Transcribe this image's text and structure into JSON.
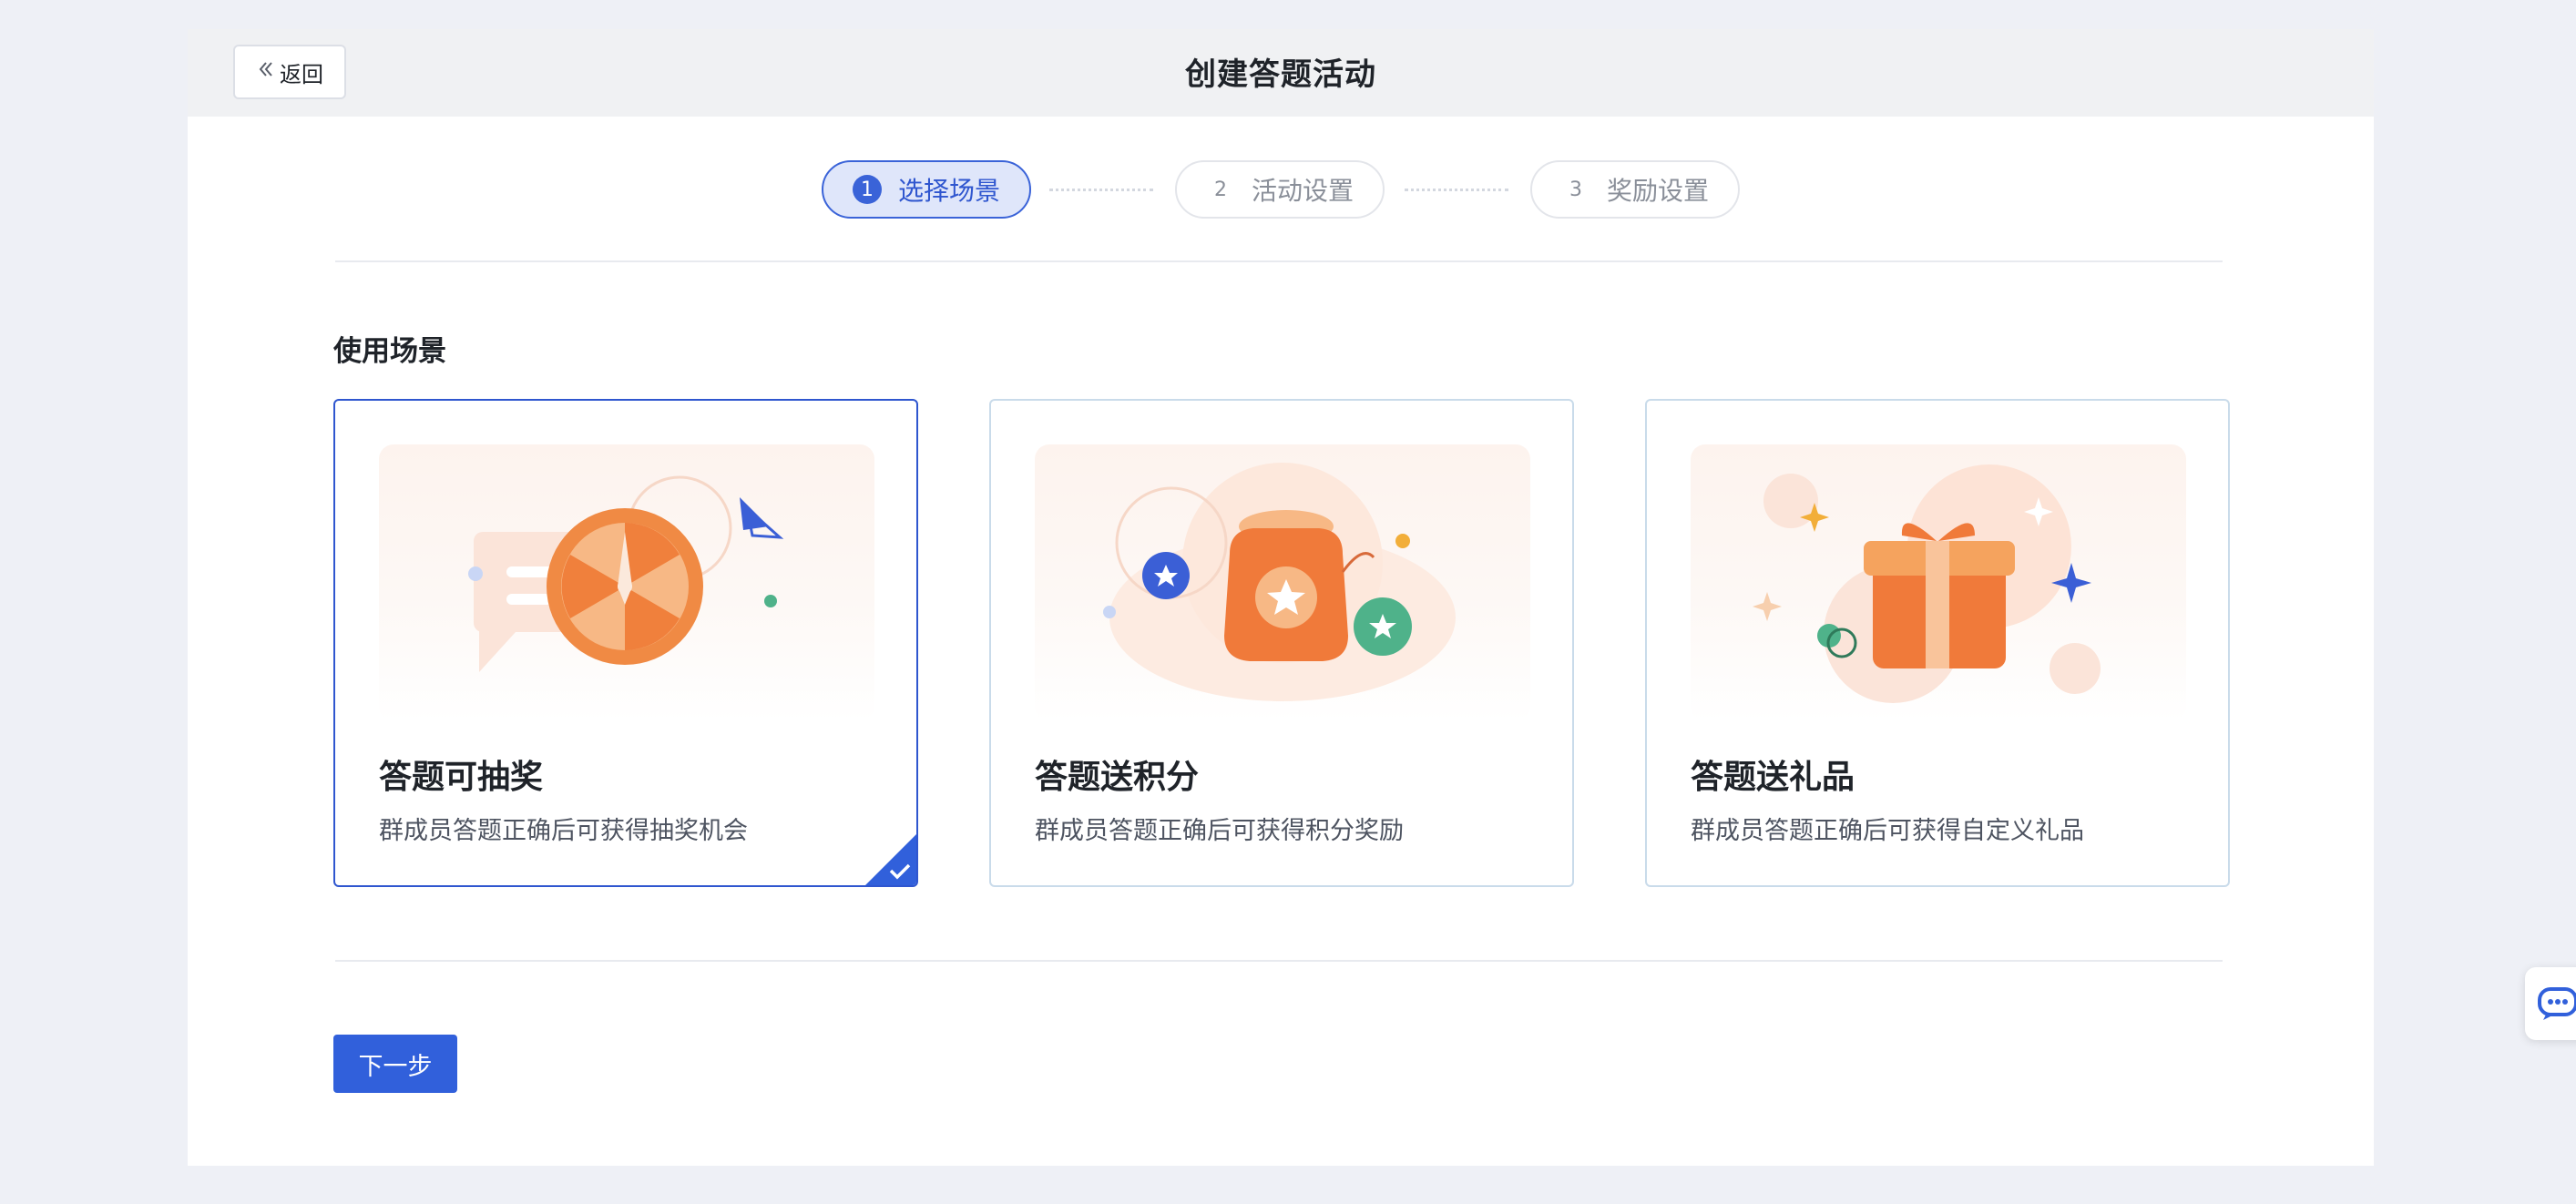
{
  "header": {
    "back_label": "返回",
    "title": "创建答题活动"
  },
  "steps": [
    {
      "number": "1",
      "label": "选择场景",
      "active": true
    },
    {
      "number": "2",
      "label": "活动设置",
      "active": false
    },
    {
      "number": "3",
      "label": "奖励设置",
      "active": false
    }
  ],
  "section": {
    "title": "使用场景"
  },
  "cards": [
    {
      "title": "答题可抽奖",
      "desc": "群成员答题正确后可获得抽奖机会",
      "selected": true,
      "icon": "prize-wheel-icon"
    },
    {
      "title": "答题送积分",
      "desc": "群成员答题正确后可获得积分奖励",
      "selected": false,
      "icon": "points-bag-icon"
    },
    {
      "title": "答题送礼品",
      "desc": "群成员答题正确后可获得自定义礼品",
      "selected": false,
      "icon": "gift-box-icon"
    }
  ],
  "footer": {
    "next_label": "下一步"
  },
  "colors": {
    "accent": "#3160db",
    "active_step_bg": "#dfe6fa",
    "illustration_orange": "#f07a3a",
    "page_bg": "#eef0f6"
  }
}
